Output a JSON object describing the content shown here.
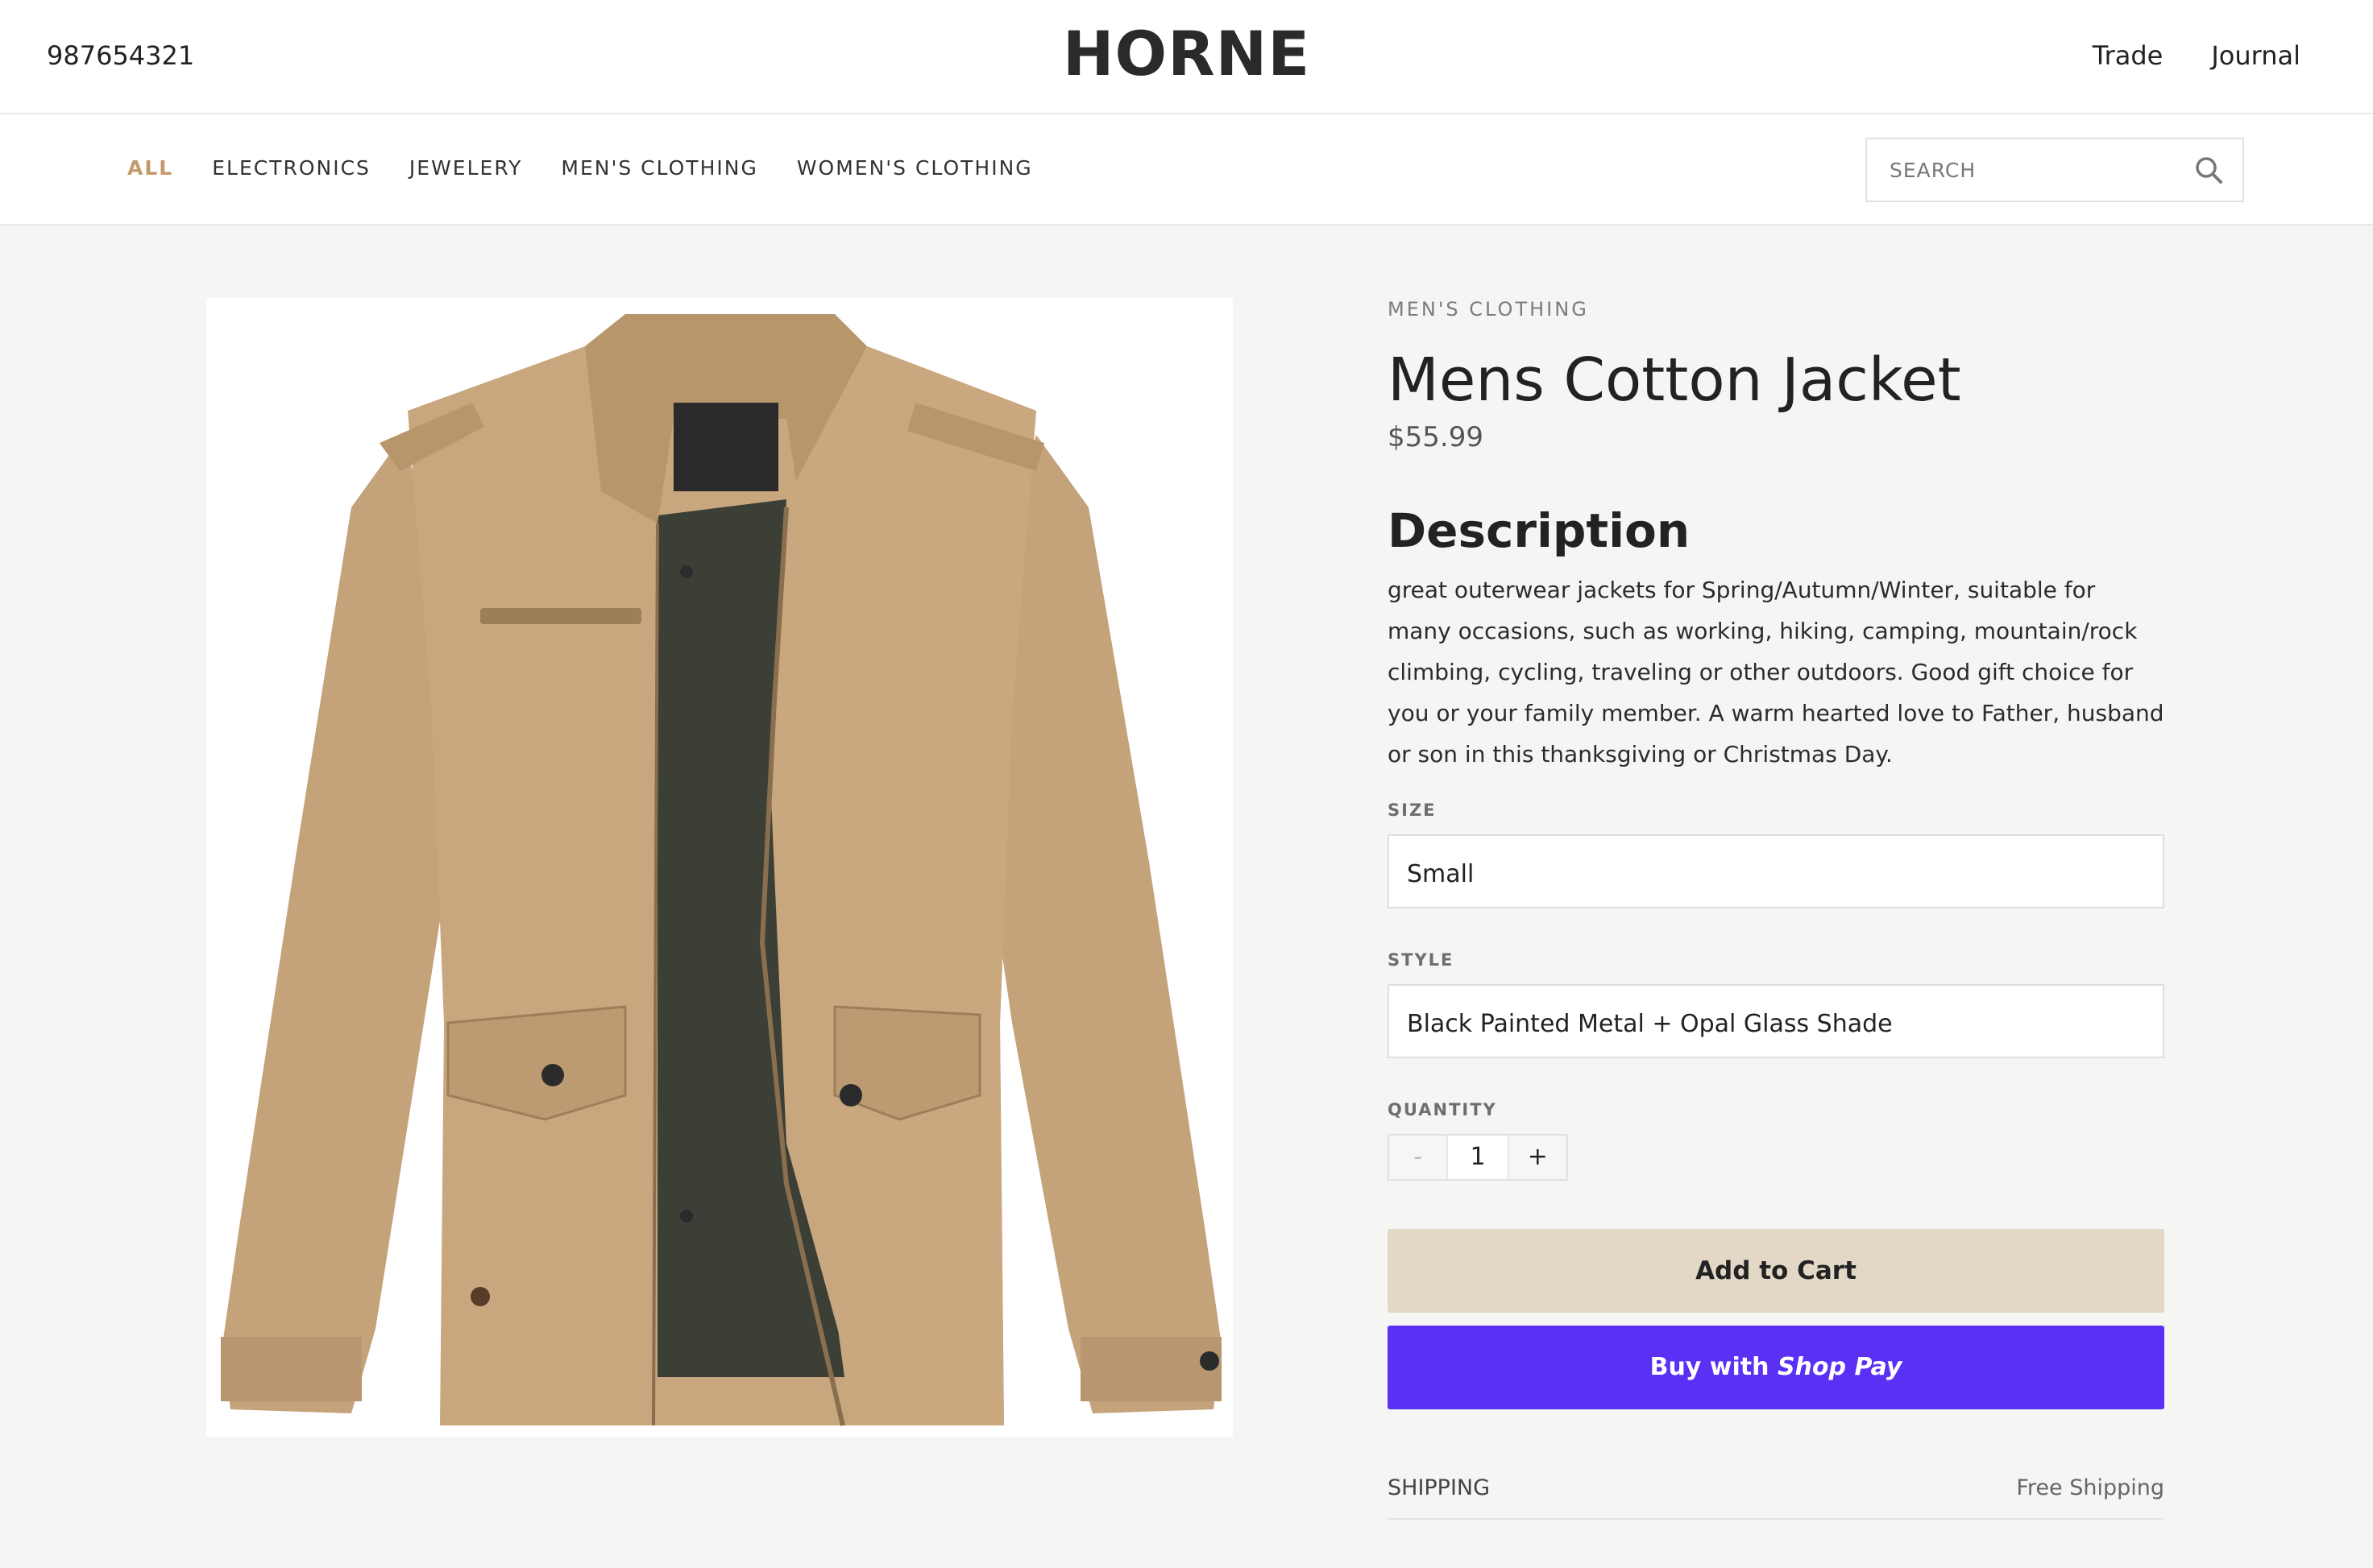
{
  "header": {
    "phone": "987654321",
    "logo": "HORNE",
    "links": [
      "Trade",
      "Journal"
    ]
  },
  "nav": {
    "categories": [
      "ALL",
      "ELECTRONICS",
      "JEWELERY",
      "MEN'S CLOTHING",
      "WOMEN'S CLOTHING"
    ],
    "active": "ALL",
    "search_placeholder": "SEARCH"
  },
  "product": {
    "category": "MEN'S CLOTHING",
    "title": "Mens Cotton Jacket",
    "price": "$55.99",
    "description_heading": "Description",
    "description": "great outerwear jackets for Spring/Autumn/Winter, suitable for many occasions, such as working, hiking, camping, mountain/rock climbing, cycling, traveling or other outdoors. Good gift choice for you or your family member. A warm hearted love to Father, husband or son in this thanksgiving or Christmas Day.",
    "size_label": "SIZE",
    "size_value": "Small",
    "style_label": "STYLE",
    "style_value": "Black Painted Metal + Opal Glass Shade",
    "quantity_label": "QUANTITY",
    "quantity": "1",
    "minus": "-",
    "plus": "+",
    "add_to_cart": "Add to Cart",
    "buy_prefix": "Buy with",
    "buy_brand": "Shop Pay",
    "shipping_label": "SHIPPING",
    "shipping_value": "Free Shipping"
  },
  "colors": {
    "accent": "#c49a6c",
    "cart_button": "#e3d7c5",
    "shop_pay": "#5a31f4",
    "jacket": "#c8a77e"
  }
}
